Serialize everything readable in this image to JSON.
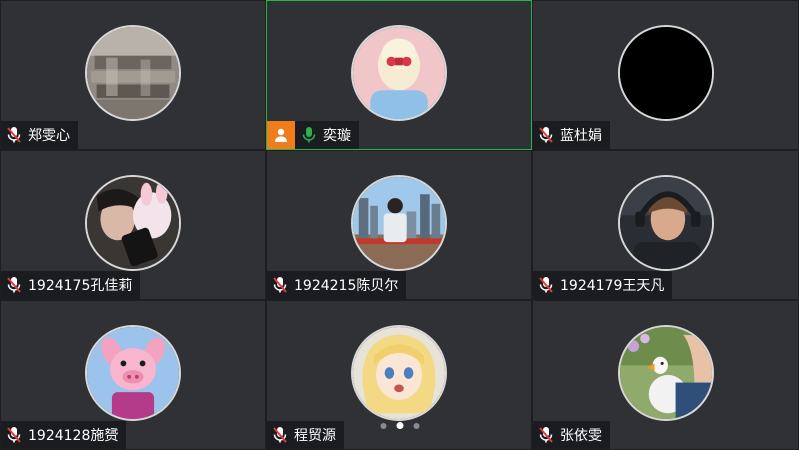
{
  "participants": [
    {
      "name": "郑雯心",
      "mic": "muted",
      "active": false,
      "host": false,
      "avatar": "photo-boxes"
    },
    {
      "name": "奕璇",
      "mic": "on",
      "active": true,
      "host": true,
      "avatar": "photo-blonde-girl"
    },
    {
      "name": "蓝杜娟",
      "mic": "muted",
      "active": false,
      "host": false,
      "avatar": "black-avatar"
    },
    {
      "name": "1924175孔佳莉",
      "mic": "muted",
      "active": false,
      "host": false,
      "avatar": "photo-person-with-toy"
    },
    {
      "name": "1924215陈贝尔",
      "mic": "muted",
      "active": false,
      "host": false,
      "avatar": "photo-city-skyline"
    },
    {
      "name": "1924179王天凡",
      "mic": "muted",
      "active": false,
      "host": false,
      "avatar": "photo-gamer-headset"
    },
    {
      "name": "1924128施赟",
      "mic": "muted",
      "active": false,
      "host": false,
      "avatar": "piglet-cartoon"
    },
    {
      "name": "程贸源",
      "mic": "muted",
      "active": false,
      "host": false,
      "avatar": "anime-girl"
    },
    {
      "name": "张依雯",
      "mic": "muted",
      "active": false,
      "host": false,
      "avatar": "duck-photo"
    }
  ],
  "pagination": {
    "total": 3,
    "current": 2
  },
  "colors": {
    "active_border": "#2ab34b",
    "host_badge": "#f07c1b",
    "mic_on": "#2ab34b",
    "mic_muted": "#e23b3b",
    "tile_bg": "#2f3134"
  },
  "icons": {
    "mic_on": "mic-icon",
    "mic_muted": "mic-muted-icon",
    "host": "host-person-icon"
  }
}
